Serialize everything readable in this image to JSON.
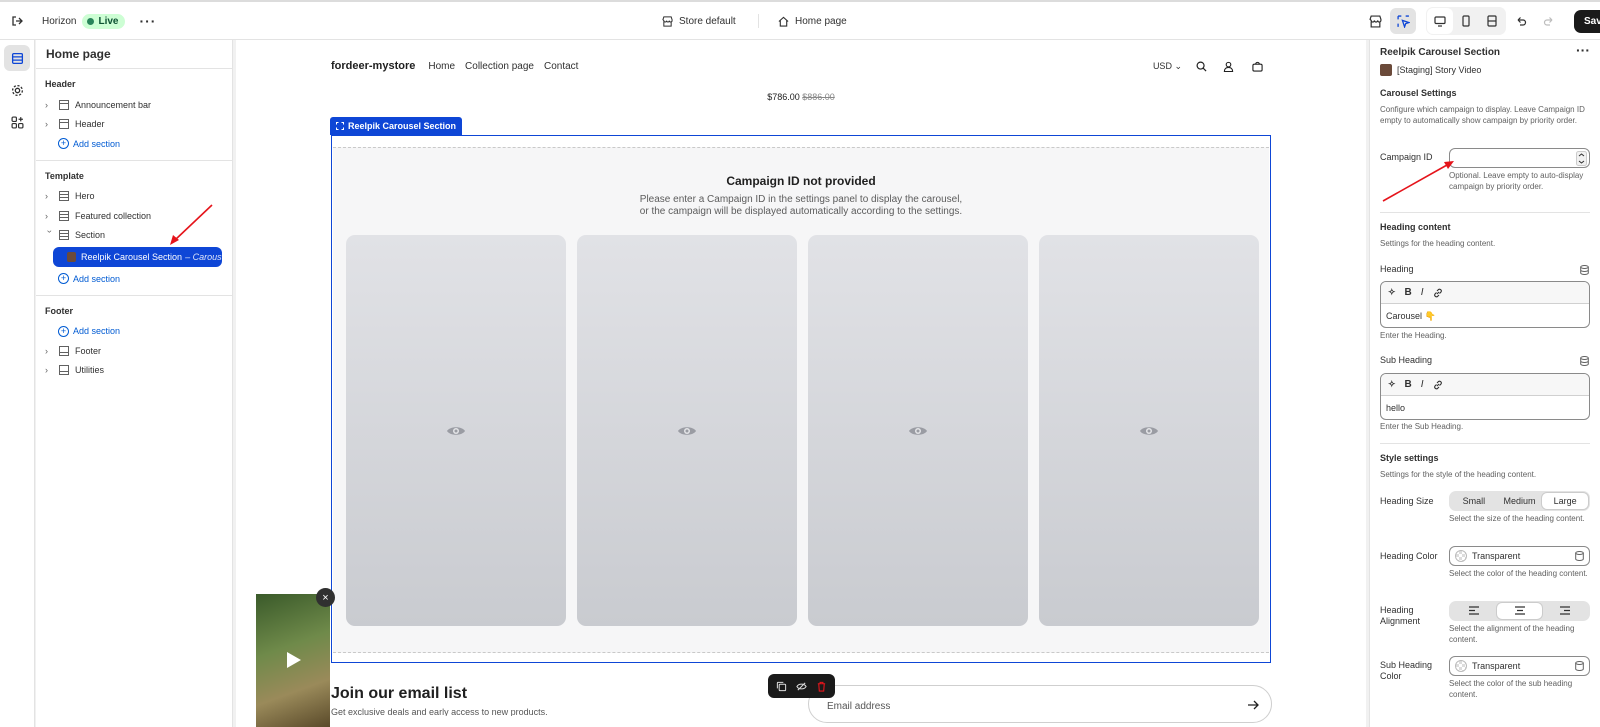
{
  "topbar": {
    "store_name": "Horizon",
    "live_label": "Live",
    "theme_selector": "Store default",
    "page_selector": "Home page",
    "save_label": "Save"
  },
  "left_panel": {
    "title": "Home page",
    "header_group": {
      "label": "Header",
      "items": [
        "Announcement bar",
        "Header"
      ],
      "add_label": "Add section"
    },
    "template_group": {
      "label": "Template",
      "items": [
        "Hero",
        "Featured collection",
        "Section"
      ],
      "selected_item": "Reelpik Carousel Section",
      "selected_suffix": "– Carous",
      "add_label": "Add section"
    },
    "footer_group": {
      "label": "Footer",
      "add_label": "Add section",
      "items": [
        "Footer",
        "Utilities"
      ]
    }
  },
  "preview": {
    "brand": "fordeer-mystore",
    "nav_links": [
      "Home",
      "Collection page",
      "Contact"
    ],
    "currency": "USD",
    "price_now": "$786.00",
    "price_was": "$886.00",
    "section_tag": "Reelpik Carousel Section",
    "empty_title": "Campaign ID not provided",
    "empty_message_line1": "Please enter a Campaign ID in the settings panel to display the carousel,",
    "empty_message_line2": "or the campaign will be displayed automatically according to the settings.",
    "card_count": 4,
    "newsletter_title": "Join our email list",
    "newsletter_sub": "Get exclusive deals and early access to new products.",
    "email_placeholder": "Email address"
  },
  "right_panel": {
    "title": "Reelpik Carousel Section",
    "app_name": "[Staging] Story Video",
    "carousel_settings": {
      "heading": "Carousel Settings",
      "help": "Configure which campaign to display. Leave Campaign ID empty to automatically show campaign by priority order.",
      "campaign_id_label": "Campaign ID",
      "campaign_id_value": "",
      "campaign_id_help": "Optional. Leave empty to auto-display campaign by priority order."
    },
    "heading_content": {
      "heading": "Heading content",
      "help": "Settings for the heading content.",
      "heading_label": "Heading",
      "heading_value": "Carousel 👇",
      "heading_help": "Enter the Heading.",
      "sub_label": "Sub Heading",
      "sub_value": "hello",
      "sub_help": "Enter the Sub Heading."
    },
    "style_settings": {
      "heading": "Style settings",
      "help": "Settings for the style of the heading content.",
      "size_label": "Heading Size",
      "size_options": [
        "Small",
        "Medium",
        "Large"
      ],
      "size_selected": "Large",
      "size_help": "Select the size of the heading content.",
      "color_label": "Heading Color",
      "color_value": "Transparent",
      "color_help": "Select the color of the heading content.",
      "align_label": "Heading Alignment",
      "align_selected": "center",
      "align_help": "Select the alignment of the heading content.",
      "sub_color_label": "Sub Heading Color",
      "sub_color_value": "Transparent",
      "sub_color_help": "Select the color of the sub heading content."
    }
  },
  "colors": {
    "accent_blue": "#0e46d6",
    "link_blue": "#005bd3",
    "annotation_red": "#e5141b",
    "live_green": "#cdfed4"
  }
}
